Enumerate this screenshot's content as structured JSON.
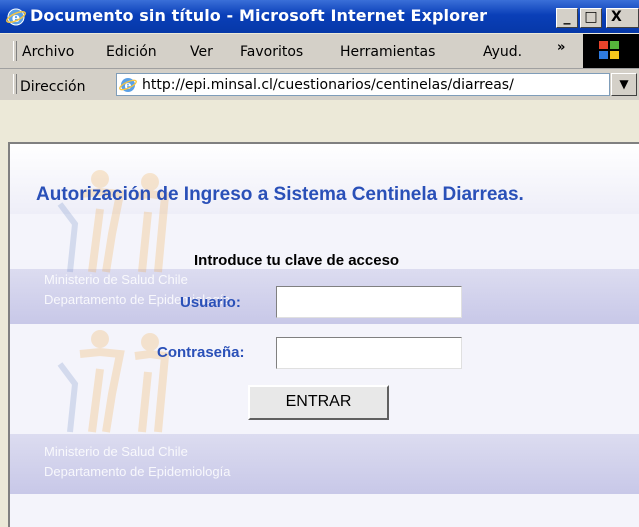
{
  "window": {
    "title": "Documento sin título - Microsoft Internet Explorer",
    "min_label": "_",
    "max_label": "□",
    "close_label": "X"
  },
  "menu": {
    "items": [
      {
        "label": "Archivo"
      },
      {
        "label": "Edición"
      },
      {
        "label": "Ver"
      },
      {
        "label": "Favoritos"
      },
      {
        "label": "Herramientas"
      },
      {
        "label": "Ayud."
      }
    ],
    "more_label": "»"
  },
  "address": {
    "label": "Dirección",
    "url": "http://epi.minsal.cl/cuestionarios/centinelas/diarreas/",
    "dropdown_label": "▼"
  },
  "page": {
    "heading": "Autorización de Ingreso a Sistema Centinela Diarreas.",
    "prompt": "Introduce tu clave de acceso",
    "user_label": "Usuario:",
    "user_value": "",
    "pass_label": "Contraseña:",
    "pass_value": "",
    "submit_label": "ENTRAR",
    "watermark_line1": "Ministerio de Salud Chile",
    "watermark_line2": "Departamento de Epidemiología"
  },
  "colors": {
    "title_bar": "#0a3fb8",
    "heading": "#2a50b8",
    "content_bg": "#f4f4fb"
  }
}
